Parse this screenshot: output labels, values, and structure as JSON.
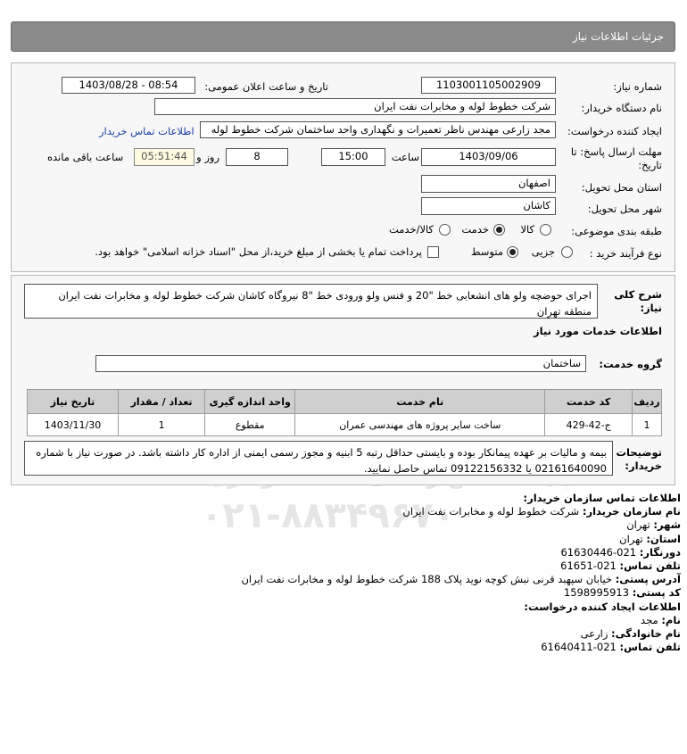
{
  "page": {
    "title": "جزئیات اطلاعات نیاز"
  },
  "form": {
    "need_number_label": "شماره نیاز:",
    "need_number": "1103001105002909",
    "announce_label": "تاریخ و ساعت اعلان عمومی:",
    "announce_value": "1403/08/28 - 08:54",
    "buyer_org_label": "نام دستگاه خریدار:",
    "buyer_org": "شرکت خطوط لوله و مخابرات نفت ایران",
    "creator_label": "ایجاد کننده درخواست:",
    "creator": "مجد  زارعی مهندس ناظر تعمیرات و نگهداری واحد ساختمان شرکت خطوط لوله",
    "contact_link": "اطلاعات تماس خریدار",
    "deadline_label_1": "مهلت ارسال پاسخ: تا",
    "deadline_label_2": "تاریخ:",
    "deadline_date": "1403/09/06",
    "time_label": "ساعت",
    "deadline_time": "15:00",
    "days_value": "8",
    "days_label": "روز و",
    "remaining_time": "05:51:44",
    "remaining_label": "ساعت باقی مانده",
    "province_label": "استان محل تحویل:",
    "province": "اصفهان",
    "city_label": "شهر محل تحویل:",
    "city": "کاشان",
    "category_label": "طبقه بندی موضوعی:",
    "cat_goods": "کالا",
    "cat_service": "خدمت",
    "cat_goods_service": "کالا/خدمت",
    "process_label": "نوع فرآیند خرید :",
    "proc_partial": "جزیی",
    "proc_medium": "متوسط",
    "payment_note": "پرداخت تمام یا بخشی از مبلغ خرید،از محل \"اسناد خزانه اسلامی\" خواهد بود."
  },
  "description": {
    "label": "شرح کلی نیاز:",
    "text": "اجرای حوضچه ولو های انشعابی خط \"20 و فنس ولو ورودی خط \"8 نیروگاه کاشان شرکت خطوط لوله و مخابرات نفت ایران منطقه تهران"
  },
  "services": {
    "section_title": "اطلاعات خدمات مورد نیاز",
    "group_label": "گروه خدمت:",
    "group_value": "ساختمان",
    "columns": [
      "ردیف",
      "کد خدمت",
      "نام خدمت",
      "واحد اندازه گیری",
      "تعداد / مقدار",
      "تاریخ نیاز"
    ],
    "rows": [
      [
        "1",
        "ج-42-429",
        "ساخت سایر پروژه های مهندسی عمران",
        "مقطوع",
        "1",
        "1403/11/30"
      ]
    ]
  },
  "buyer_notes": {
    "label": "توضیحات خریدار:",
    "text": "بیمه و مالیات بر عهده پیمانکار بوده و بایستی حداقل رتبه 5 ابنیه و مجوز رسمی ایمنی از اداره کار داشته باشد. در صورت نیاز با شماره 02161640090 یا 09122156332 تماس حاصل نمایید."
  },
  "contact": {
    "title": "اطلاعات تماس سازمان خریدار:",
    "org_label": "نام سازمان خریدار:",
    "org": "شرکت خطوط لوله و مخابرات نفت ایران",
    "city_label": "شهر:",
    "city": "تهران",
    "province_label": "استان:",
    "province": "تهران",
    "fax_label": "دورنگار:",
    "fax": "021-61630446",
    "phone_label": "تلفن تماس:",
    "phone": "021-61651",
    "address_label": "آدرس پستی:",
    "address": "خیابان سپهبد قرنی نبش کوچه نوید پلاک 188 شرکت خطوط لوله و مخابرات نفت ایران",
    "postal_label": "کد پستی:",
    "postal": "1598995913",
    "creator_title": "اطلاعات ایجاد کننده درخواست:",
    "name_label": "نام:",
    "name": "مجد",
    "family_label": "نام خانوادگی:",
    "family": "زارعی",
    "creator_phone_label": "تلفن تماس:",
    "creator_phone": "021-61640411"
  },
  "watermark": {
    "brand": "ParsNamadData",
    "subtitle": "پایگاه اطلاع رسانی مناقصه و مزایده",
    "phone": "۰۲۱-۸۸۳۴۹۶۷۰"
  }
}
